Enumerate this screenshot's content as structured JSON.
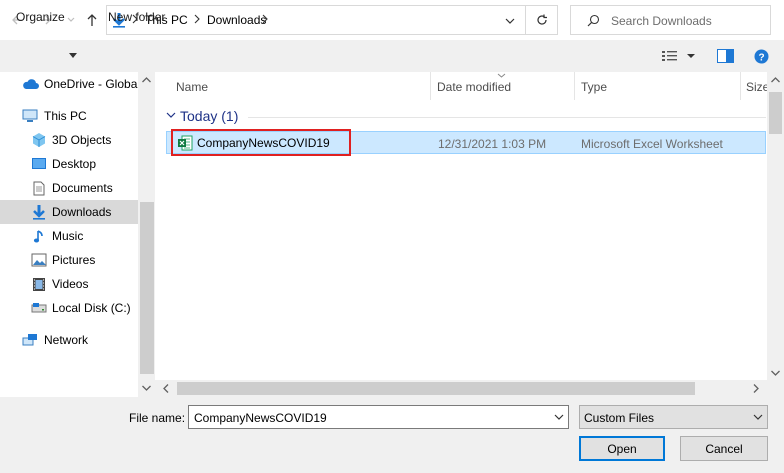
{
  "address": {
    "segments": [
      "This PC",
      "Downloads"
    ]
  },
  "search": {
    "placeholder": "Search Downloads"
  },
  "toolbar": {
    "organize": "Organize",
    "new_folder": "New folder"
  },
  "sidebar": {
    "items": [
      {
        "label": "OneDrive - Global",
        "icon": "onedrive-cloud-icon"
      },
      {
        "label": "This PC",
        "icon": "computer-icon"
      },
      {
        "label": "3D Objects",
        "icon": "3d-objects-icon"
      },
      {
        "label": "Desktop",
        "icon": "desktop-icon"
      },
      {
        "label": "Documents",
        "icon": "documents-icon"
      },
      {
        "label": "Downloads",
        "icon": "downloads-icon"
      },
      {
        "label": "Music",
        "icon": "music-icon"
      },
      {
        "label": "Pictures",
        "icon": "pictures-icon"
      },
      {
        "label": "Videos",
        "icon": "videos-icon"
      },
      {
        "label": "Local Disk (C:)",
        "icon": "local-disk-icon"
      },
      {
        "label": "Network",
        "icon": "network-icon"
      }
    ]
  },
  "columns": {
    "name": "Name",
    "date_modified": "Date modified",
    "type": "Type",
    "size": "Size"
  },
  "group": {
    "label": "Today (1)"
  },
  "files": [
    {
      "name": "CompanyNewsCOVID19",
      "date": "12/31/2021 1:03 PM",
      "type": "Microsoft Excel Worksheet"
    }
  ],
  "footer": {
    "file_name_label": "File name:",
    "file_name_value": "CompanyNewsCOVID19",
    "file_type": "Custom Files",
    "open": "Open",
    "cancel": "Cancel"
  },
  "colors": {
    "selection": "#cce8ff",
    "accent": "#0078d7",
    "highlight": "#e02020"
  }
}
